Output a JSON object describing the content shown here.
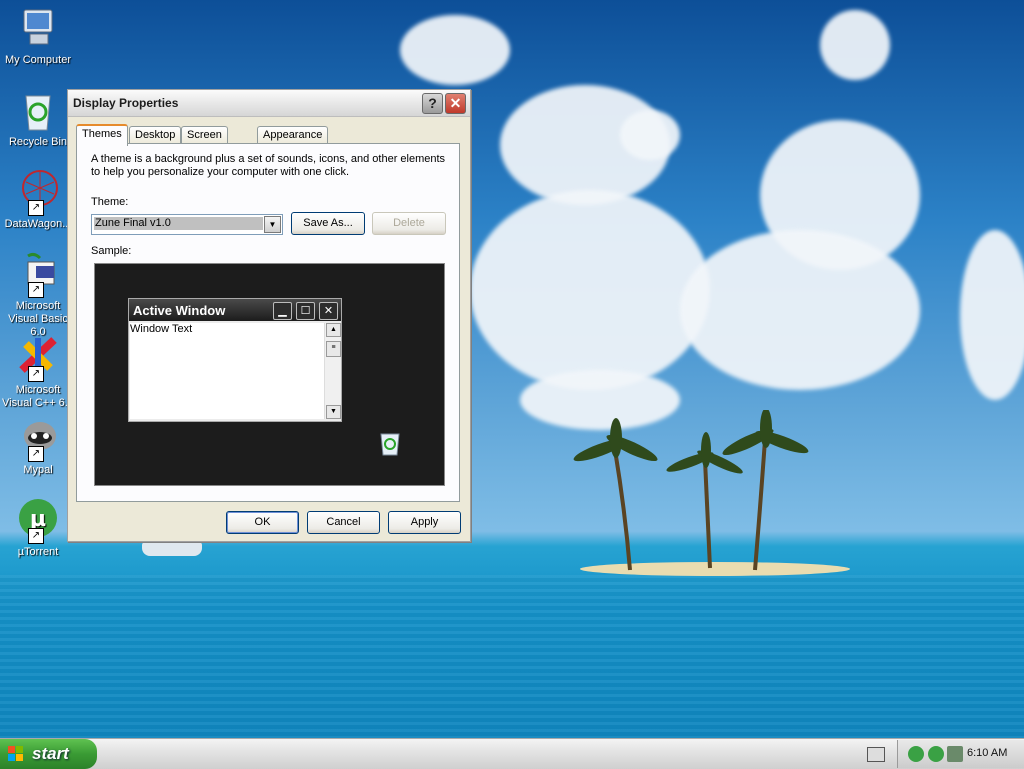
{
  "desktop": {
    "icons": [
      {
        "label": "My Computer",
        "icon": "computer-icon"
      },
      {
        "label": "Recycle Bin",
        "icon": "recycle-bin-icon"
      },
      {
        "label": "DataWagon...",
        "icon": "datawagon-icon"
      },
      {
        "label": "Microsoft Visual Basic 6.0",
        "icon": "visual-basic-icon"
      },
      {
        "label": "Microsoft Visual C++ 6.0",
        "icon": "visual-cpp-icon"
      },
      {
        "label": "Mypal",
        "icon": "mypal-icon"
      },
      {
        "label": "µTorrent",
        "icon": "utorrent-icon"
      }
    ]
  },
  "dialog": {
    "title": "Display Properties",
    "help_label": "?",
    "close_label": "✕",
    "tabs": [
      "Themes",
      "Desktop",
      "Screen Saver",
      "Appearance"
    ],
    "active_tab": "Themes",
    "description": "A theme is a background plus a set of sounds, icons, and other elements to help you personalize your computer with one click.",
    "theme_label": "Theme:",
    "theme_value": "Zune Final v1.0",
    "save_as_label": "Save As...",
    "delete_label": "Delete",
    "sample_label": "Sample:",
    "sample": {
      "window_title": "Active Window",
      "window_text": "Window Text"
    },
    "ok_label": "OK",
    "cancel_label": "Cancel",
    "apply_label": "Apply"
  },
  "taskbar": {
    "start_label": "start",
    "clock": "6:10 AM"
  },
  "colors": {
    "start_green": "#3a9b34",
    "active_tab_accent": "#e68b2c",
    "close_red": "#c0392b",
    "button_border": "#003c74"
  }
}
